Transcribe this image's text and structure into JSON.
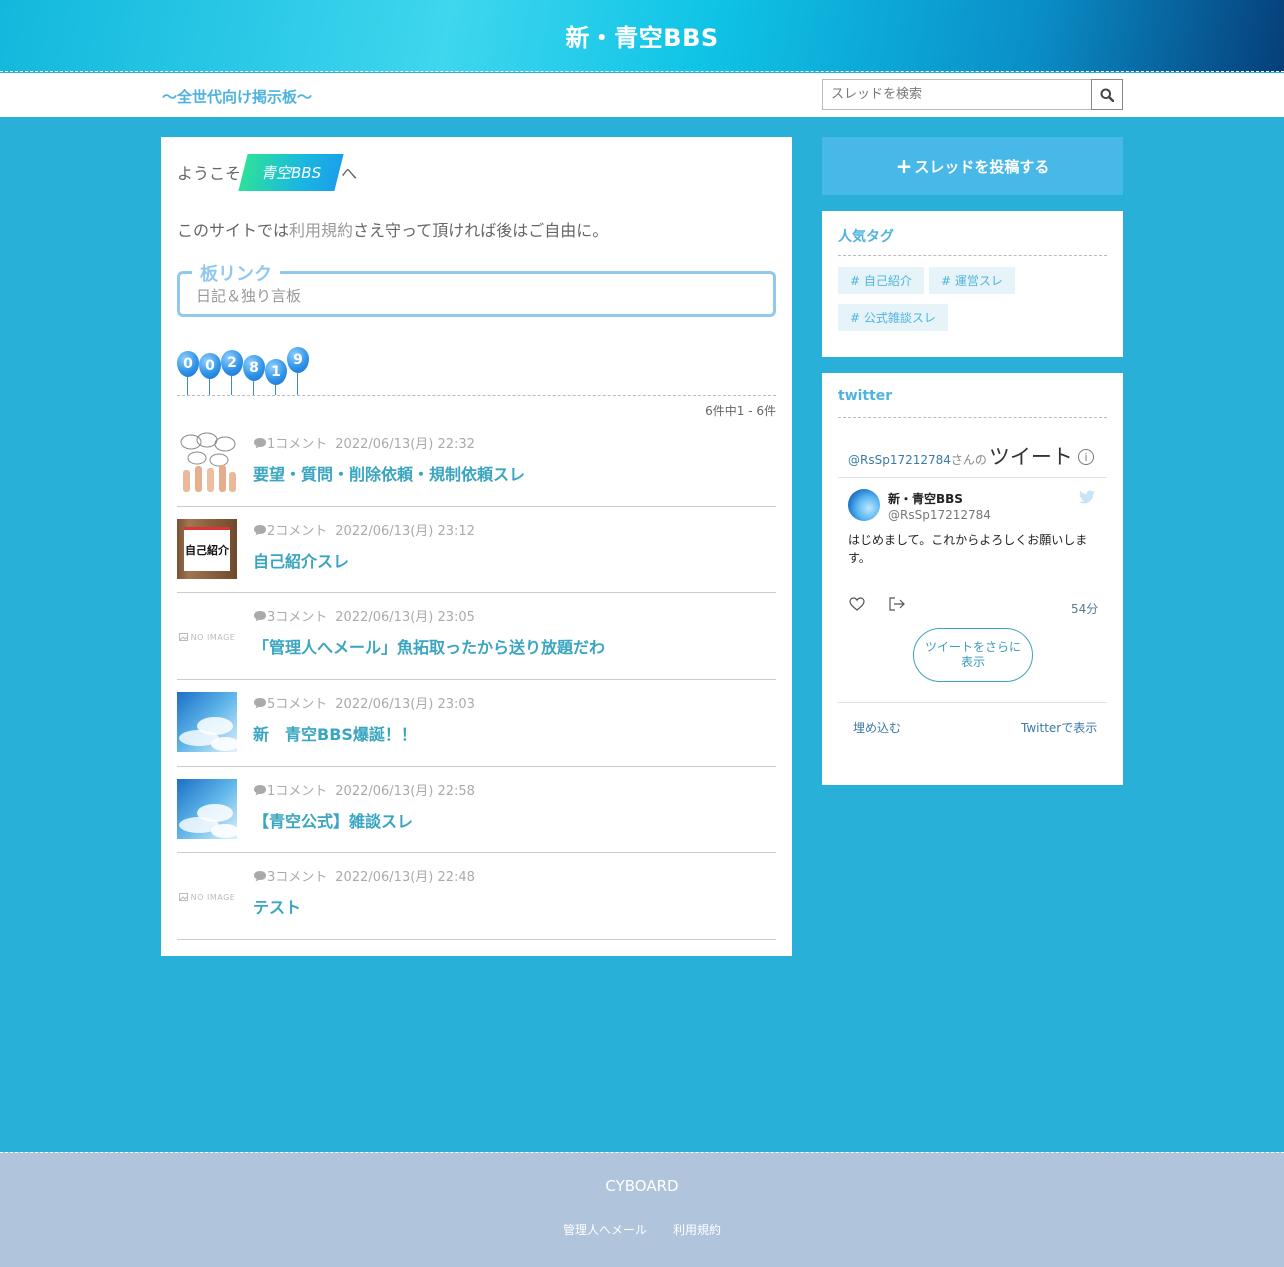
{
  "header": {
    "title": "新・青空BBS",
    "tagline": "～全世代向け掲示板～",
    "search_placeholder": "スレッドを検索"
  },
  "welcome": {
    "prefix": "ようこそ",
    "badge": "青空BBS",
    "suffix": "へ"
  },
  "rules": {
    "before": "このサイトでは",
    "link": "利用規約",
    "after": "さえ守って頂ければ後はご自由に。"
  },
  "board_links": {
    "legend": "板リンク",
    "items": [
      "日記＆独り言板"
    ]
  },
  "counter": [
    "0",
    "0",
    "2",
    "8",
    "1",
    "9"
  ],
  "pagination": "6件中1 - 6件",
  "threads": [
    {
      "comments": "1コメント",
      "date": "2022/06/13(月) 22:32",
      "title": "要望・質問・削除依頼・規制依頼スレ",
      "thumb": "hands"
    },
    {
      "comments": "2コメント",
      "date": "2022/06/13(月) 23:12",
      "title": "自己紹介スレ",
      "thumb": "intro",
      "thumb_text": "自己紹介"
    },
    {
      "comments": "3コメント",
      "date": "2022/06/13(月) 23:05",
      "title": "「管理人へメール」魚拓取ったから送り放題だわ",
      "thumb": "noimage",
      "thumb_text": "NO IMAGE"
    },
    {
      "comments": "5コメント",
      "date": "2022/06/13(月) 23:03",
      "title": "新　青空BBS爆誕！！",
      "thumb": "sky"
    },
    {
      "comments": "1コメント",
      "date": "2022/06/13(月) 22:58",
      "title": "【青空公式】雑談スレ",
      "thumb": "sky"
    },
    {
      "comments": "3コメント",
      "date": "2022/06/13(月) 22:48",
      "title": "テスト",
      "thumb": "noimage",
      "thumb_text": "NO IMAGE"
    }
  ],
  "sidebar": {
    "post_button": "スレッドを投稿する",
    "popular_tags_title": "人気タグ",
    "tags": [
      "# 自己紹介",
      "# 運営スレ",
      "# 公式雑談スレ"
    ],
    "twitter_title": "twitter",
    "twitter": {
      "header_user": "@RsSp17212784",
      "header_san": "さんの",
      "header_tweet": "ツイート",
      "name": "新・青空BBS",
      "handle": "@RsSp17212784",
      "body": "はじめまして。これからよろしくお願いします。",
      "time": "54分",
      "more": "ツイートをさらに表示",
      "embed": "埋め込む",
      "view": "Twitterで表示"
    }
  },
  "footer": {
    "brand": "CYBOARD",
    "links": [
      "管理人へメール",
      "利用規約"
    ]
  },
  "colors": {
    "background": "#28b0d8",
    "accent": "#4fb3e0",
    "thread_title": "#3aa5c0",
    "post_button": "#48b8e8",
    "footer": "#b0c4dc"
  }
}
